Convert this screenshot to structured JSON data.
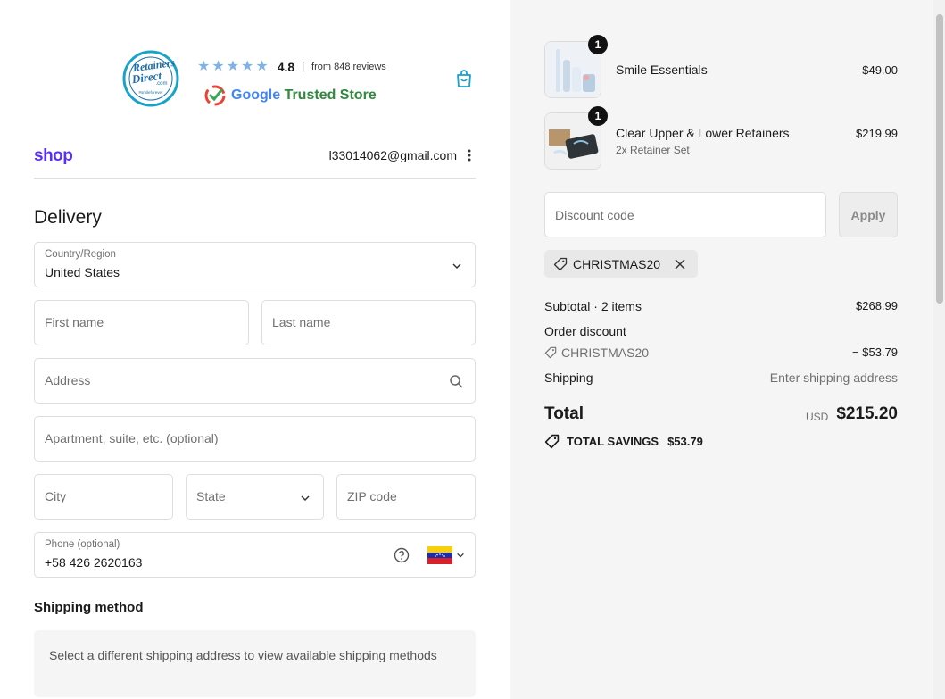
{
  "header": {
    "rating_value": "4.8",
    "rating_separator": "|",
    "review_count": "from 848 reviews",
    "google_word": "Google",
    "trusted_store": "Trusted Store",
    "stars_count": 5
  },
  "account": {
    "shop_logo": "shop",
    "email": "l33014062@gmail.com"
  },
  "delivery": {
    "heading": "Delivery",
    "country_label": "Country/Region",
    "country_value": "United States",
    "first_name_placeholder": "First name",
    "last_name_placeholder": "Last name",
    "address_placeholder": "Address",
    "apartment_placeholder": "Apartment, suite, etc. (optional)",
    "city_placeholder": "City",
    "state_placeholder": "State",
    "zip_placeholder": "ZIP code",
    "phone_label": "Phone (optional)",
    "phone_value": "+58 426 2620163"
  },
  "shipping_method": {
    "heading": "Shipping method",
    "message": "Select a different shipping address to view available shipping methods"
  },
  "cart": {
    "items": [
      {
        "name": "Smile Essentials",
        "variant": "",
        "price": "$49.00",
        "quantity": "1"
      },
      {
        "name": "Clear Upper & Lower Retainers",
        "variant": "2x Retainer Set",
        "price": "$219.99",
        "quantity": "1"
      }
    ],
    "discount_placeholder": "Discount code",
    "apply_label": "Apply",
    "applied_code": "CHRISTMAS20"
  },
  "summary": {
    "subtotal_label": "Subtotal · 2 items",
    "subtotal_value": "$268.99",
    "order_discount_label": "Order discount",
    "discount_code": "CHRISTMAS20",
    "discount_value": "− $53.79",
    "shipping_label": "Shipping",
    "shipping_value": "Enter shipping address",
    "total_label": "Total",
    "currency": "USD",
    "total_value": "$215.20",
    "savings_label": "TOTAL SAVINGS",
    "savings_value": "$53.79"
  },
  "colors": {
    "shop_purple": "#5a31f4",
    "cart_icon": "#1aa3c8",
    "panel_bg": "#f5f5f5"
  }
}
